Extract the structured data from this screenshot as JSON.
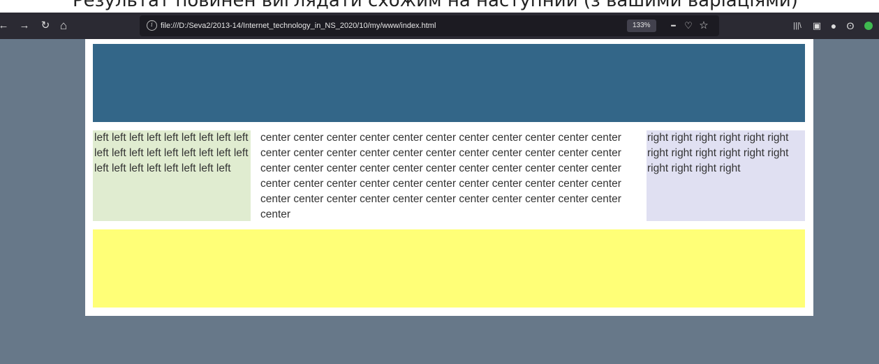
{
  "slide": {
    "caption": "Результат повинен виглядати схожим на наступний (з вашими варіаціями)"
  },
  "browser": {
    "nav": {
      "back_glyph": "←",
      "forward_glyph": "→",
      "reload_glyph": "↻",
      "home_glyph": "⌂"
    },
    "url_info_glyph": "i",
    "url": "file:///D:/Seva2/2013-14/Internet_technology_in_NS_2020/10/my/www/index.html",
    "zoom": "133%",
    "actions": {
      "more_glyph": "•••",
      "pocket_glyph": "♡",
      "bookmark_glyph": "☆"
    },
    "toolbar_icons": {
      "library_glyph": "|||\\",
      "sidebar_glyph": "▣",
      "extension_glyph": "●",
      "account_glyph": "ʘ"
    }
  },
  "layout_colors": {
    "background": "#677889",
    "header": "#336688",
    "left": "#e0ecd0",
    "right": "#e0e0f2",
    "footer": "#ffff77"
  },
  "content": {
    "left_text": "left left left left left left left left left left left left left left left left left left left left left left left left left left",
    "center_text": "center center center center center center center center center center center center center center center center center center center center center center center center center center center center center center center center center center center center center center center center center center center center center center center center center center center center center center center center",
    "right_text": "right right right right right right right right right right right right right right right right"
  }
}
